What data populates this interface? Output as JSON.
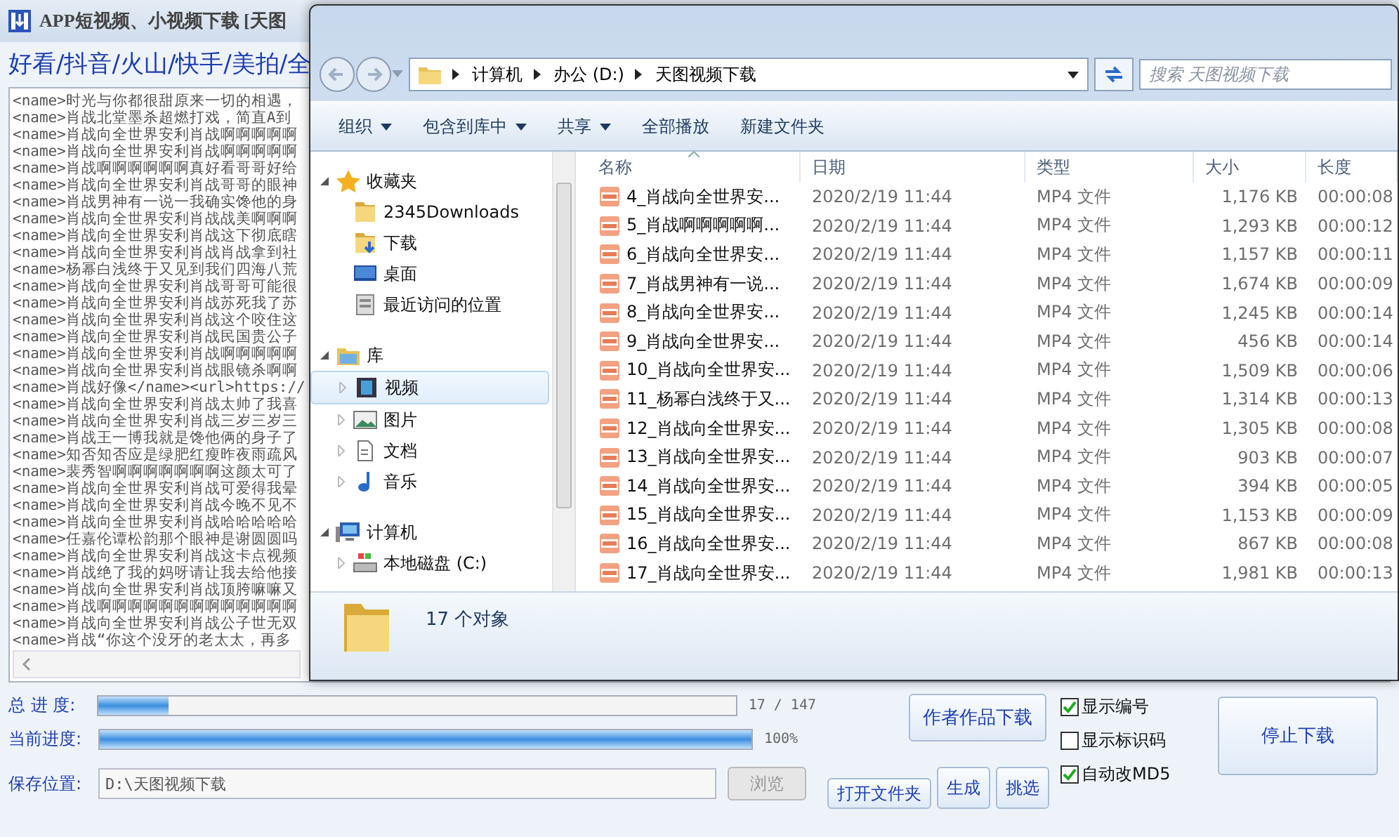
{
  "app": {
    "title": "APP短视频、小视频下载 [天图",
    "platforms": "好看/抖音/火山/快手/美拍/全",
    "log_lines": [
      "<name>时光与你都很甜原来一切的相遇，",
      "<name>肖战北堂墨杀超燃打戏，简直A到",
      "<name>肖战向全世界安利肖战啊啊啊啊啊",
      "<name>肖战向全世界安利肖战啊啊啊啊啊",
      "<name>肖战啊啊啊啊啊啊真好看哥哥好给",
      "<name>肖战向全世界安利肖战哥哥的眼神",
      "<name>肖战男神有一说一我确实馋他的身",
      "<name>肖战向全世界安利肖战战美啊啊啊",
      "<name>肖战向全世界安利肖战这下彻底瞎",
      "<name>肖战向全世界安利肖战肖战拿到社",
      "<name>杨幂白浅终于又见到我们四海八荒",
      "<name>肖战向全世界安利肖战哥哥可能很",
      "<name>肖战向全世界安利肖战苏死我了苏",
      "<name>肖战向全世界安利肖战这个咬住这",
      "<name>肖战向全世界安利肖战民国贵公子",
      "<name>肖战向全世界安利肖战啊啊啊啊啊",
      "<name>肖战向全世界安利肖战眼镜杀啊啊",
      "<name>肖战好像</name><url>https://",
      "<name>肖战向全世界安利肖战太帅了我喜",
      "<name>肖战向全世界安利肖战三岁三岁三",
      "<name>肖战王一博我就是馋他俩的身子了",
      "<name>知否知否应是绿肥红瘦昨夜雨疏风",
      "<name>裴秀智啊啊啊啊啊啊啊这颜太可了",
      "<name>肖战向全世界安利肖战可爱得我晕",
      "<name>肖战向全世界安利肖战今晚不见不",
      "<name>肖战向全世界安利肖战哈哈哈哈哈",
      "<name>任嘉伦谭松韵那个眼神是谢圆圆吗",
      "<name>肖战向全世界安利肖战这卡点视频",
      "<name>肖战绝了我的妈呀请让我去给他接",
      "<name>肖战向全世界安利肖战顶胯嘛嘛又",
      "<name>肖战啊啊啊啊啊啊啊啊啊啊啊啊啊",
      "<name>肖战向全世界安利肖战公子世无双",
      "<name>肖战“你这个没牙的老太太，再多"
    ]
  },
  "explorer": {
    "breadcrumbs": [
      "计算机",
      "办公 (D:)",
      "天图视频下载"
    ],
    "search": {
      "placeholder": "搜索 天图视频下载"
    },
    "toolbar": [
      {
        "label": "组织",
        "dropdown": true
      },
      {
        "label": "包含到库中",
        "dropdown": true
      },
      {
        "label": "共享",
        "dropdown": true
      },
      {
        "label": "全部播放",
        "dropdown": false
      },
      {
        "label": "新建文件夹",
        "dropdown": false
      }
    ],
    "nav_tree": [
      {
        "label": "收藏夹",
        "kind": "star",
        "expanded": true,
        "selected": false,
        "children": [
          {
            "label": "2345Downloads",
            "kind": "folder",
            "selected": false
          },
          {
            "label": "下载",
            "kind": "download",
            "selected": false
          },
          {
            "label": "桌面",
            "kind": "desktop",
            "selected": false
          },
          {
            "label": "最近访问的位置",
            "kind": "recent",
            "selected": false
          }
        ]
      },
      {
        "label": "库",
        "kind": "library",
        "expanded": true,
        "selected": false,
        "children": [
          {
            "label": "视频",
            "kind": "video",
            "expanded": false,
            "selected": true
          },
          {
            "label": "图片",
            "kind": "picture",
            "expanded": false,
            "selected": false
          },
          {
            "label": "文档",
            "kind": "document",
            "expanded": false,
            "selected": false
          },
          {
            "label": "音乐",
            "kind": "music",
            "expanded": false,
            "selected": false
          }
        ]
      },
      {
        "label": "计算机",
        "kind": "computer",
        "expanded": true,
        "selected": false,
        "children": [
          {
            "label": "本地磁盘 (C:)",
            "kind": "drive",
            "expanded": false,
            "selected": false
          }
        ]
      }
    ],
    "columns": [
      {
        "label": "名称",
        "sorted": true
      },
      {
        "label": "日期",
        "sorted": false
      },
      {
        "label": "类型",
        "sorted": false
      },
      {
        "label": "大小",
        "sorted": false
      },
      {
        "label": "长度",
        "sorted": false
      }
    ],
    "files": [
      {
        "name": "4_肖战向全世界安...",
        "date": "2020/2/19 11:44",
        "type": "MP4 文件",
        "size": "1,176 KB",
        "length": "00:00:08"
      },
      {
        "name": "5_肖战啊啊啊啊啊...",
        "date": "2020/2/19 11:44",
        "type": "MP4 文件",
        "size": "1,293 KB",
        "length": "00:00:12"
      },
      {
        "name": "6_肖战向全世界安...",
        "date": "2020/2/19 11:44",
        "type": "MP4 文件",
        "size": "1,157 KB",
        "length": "00:00:11"
      },
      {
        "name": "7_肖战男神有一说...",
        "date": "2020/2/19 11:44",
        "type": "MP4 文件",
        "size": "1,674 KB",
        "length": "00:00:09"
      },
      {
        "name": "8_肖战向全世界安...",
        "date": "2020/2/19 11:44",
        "type": "MP4 文件",
        "size": "1,245 KB",
        "length": "00:00:14"
      },
      {
        "name": "9_肖战向全世界安...",
        "date": "2020/2/19 11:44",
        "type": "MP4 文件",
        "size": "456 KB",
        "length": "00:00:14"
      },
      {
        "name": "10_肖战向全世界安...",
        "date": "2020/2/19 11:44",
        "type": "MP4 文件",
        "size": "1,509 KB",
        "length": "00:00:06"
      },
      {
        "name": "11_杨幂白浅终于又...",
        "date": "2020/2/19 11:44",
        "type": "MP4 文件",
        "size": "1,314 KB",
        "length": "00:00:13"
      },
      {
        "name": "12_肖战向全世界安...",
        "date": "2020/2/19 11:44",
        "type": "MP4 文件",
        "size": "1,305 KB",
        "length": "00:00:08"
      },
      {
        "name": "13_肖战向全世界安...",
        "date": "2020/2/19 11:44",
        "type": "MP4 文件",
        "size": "903 KB",
        "length": "00:00:07"
      },
      {
        "name": "14_肖战向全世界安...",
        "date": "2020/2/19 11:44",
        "type": "MP4 文件",
        "size": "394 KB",
        "length": "00:00:05"
      },
      {
        "name": "15_肖战向全世界安...",
        "date": "2020/2/19 11:44",
        "type": "MP4 文件",
        "size": "1,153 KB",
        "length": "00:00:09"
      },
      {
        "name": "16_肖战向全世界安...",
        "date": "2020/2/19 11:44",
        "type": "MP4 文件",
        "size": "867 KB",
        "length": "00:00:08"
      },
      {
        "name": "17_肖战向全世界安...",
        "date": "2020/2/19 11:44",
        "type": "MP4 文件",
        "size": "1,981 KB",
        "length": "00:00:13"
      }
    ],
    "status": "17 个对象"
  },
  "controls": {
    "progress": [
      {
        "label": "总 进 度:",
        "level": 0.11,
        "reading": "17 / 147"
      },
      {
        "label": "当前进度:",
        "level": 1.0,
        "reading": "100%"
      }
    ],
    "save": {
      "label": "保存位置:",
      "value": "D:\\天图视频下载",
      "browse": {
        "label": "浏览",
        "disabled": true
      },
      "open_folder": "打开文件夹"
    },
    "author_download": "作者作品下载",
    "generate": "生成",
    "pick": "挑选",
    "options": [
      {
        "label": "显示编号",
        "checked": true
      },
      {
        "label": "显示标识码",
        "checked": false
      },
      {
        "label": "自动改MD5",
        "checked": true
      }
    ],
    "stop": "停止下载"
  }
}
